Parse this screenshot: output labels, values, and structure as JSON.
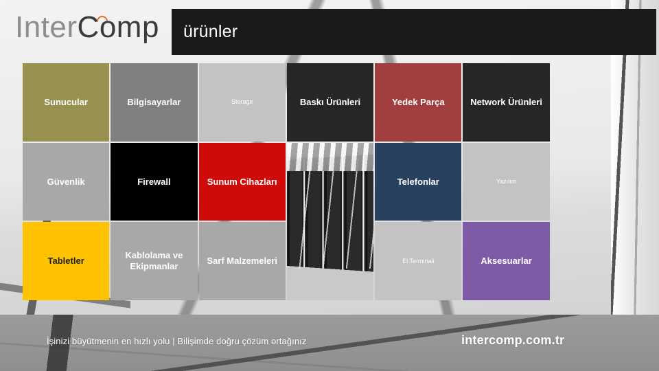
{
  "header": {
    "logo_part_a": "Inter",
    "logo_part_b": "Comp",
    "logo_accent_color": "#e0732a",
    "title": "ürünler",
    "title_bar_color": "#1a1a1a"
  },
  "grid": {
    "tiles": [
      {
        "label": "Sunucular",
        "bg": "#99914f",
        "text_style": "strong",
        "row": 1,
        "col": 1
      },
      {
        "label": "Bilgisayarlar",
        "bg": "#808080",
        "text_style": "strong",
        "row": 1,
        "col": 2
      },
      {
        "label": "Storage",
        "bg": "#c3c3c3",
        "text_style": "small",
        "row": 1,
        "col": 3
      },
      {
        "label": "Baskı Ürünleri",
        "bg": "#262626",
        "text_style": "strong",
        "row": 1,
        "col": 4
      },
      {
        "label": "Yedek Parça",
        "bg": "#a13f3f",
        "text_style": "strong",
        "row": 1,
        "col": 5
      },
      {
        "label": "Network Ürünleri",
        "bg": "#262626",
        "text_style": "strong",
        "row": 1,
        "col": 6
      },
      {
        "label": "Güvenlik",
        "bg": "#a8a8a8",
        "text_style": "strong",
        "row": 2,
        "col": 1
      },
      {
        "label": "Firewall",
        "bg": "#000000",
        "text_style": "strong",
        "row": 2,
        "col": 2
      },
      {
        "label": "Sunum Cihazları",
        "bg": "#cf0a0a",
        "text_style": "strong",
        "row": 2,
        "col": 3
      },
      {
        "label": "Telefonlar",
        "bg": "#27415f",
        "text_style": "strong",
        "row": 2,
        "col": 5
      },
      {
        "label": "Yazılım",
        "bg": "#c3c3c3",
        "text_style": "small",
        "row": 2,
        "col": 6
      },
      {
        "label": "Tabletler",
        "bg": "#ffc200",
        "text_style": "dark",
        "row": 3,
        "col": 1
      },
      {
        "label": "Kablolama ve Ekipmanlar",
        "bg": "#a8a8a8",
        "text_style": "strong",
        "row": 3,
        "col": 2
      },
      {
        "label": "Sarf Malzemeleri",
        "bg": "#a8a8a8",
        "text_style": "strong",
        "row": 3,
        "col": 3
      },
      {
        "label": "El Terminali",
        "bg": "#c3c3c3",
        "text_style": "small",
        "row": 3,
        "col": 5
      },
      {
        "label": "Aksesuarlar",
        "bg": "#7e5ba6",
        "text_style": "strong",
        "row": 3,
        "col": 6
      }
    ],
    "photo_tile": {
      "name": "server-rack-photo",
      "description": "black and white photograph of vintage mainframe server racks"
    }
  },
  "footer": {
    "tagline": "İşinizi büyütmenin en hızlı yolu | Bilişimde doğru çözüm ortağınız",
    "website": "intercomp.com.tr"
  }
}
